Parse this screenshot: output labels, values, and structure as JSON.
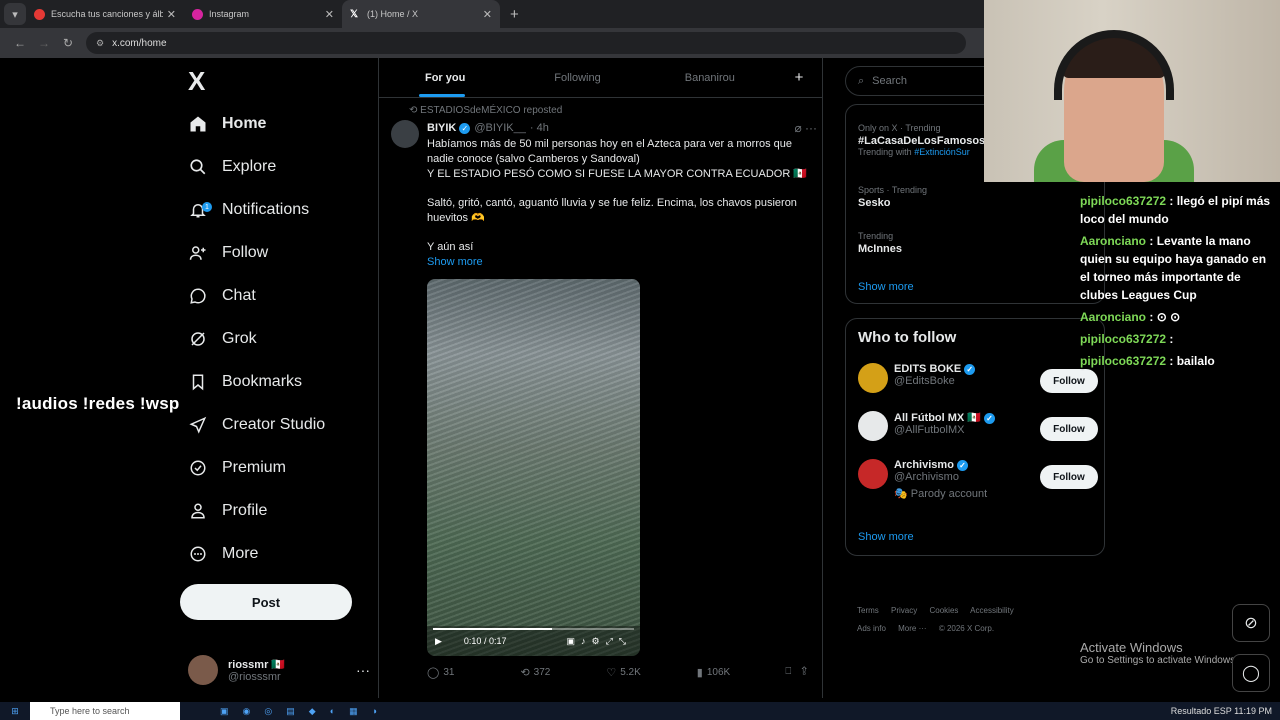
{
  "browser": {
    "tabs": [
      {
        "title": "Escucha tus canciones y álbum",
        "color": "#e53935",
        "active": false
      },
      {
        "title": "Instagram",
        "color": "#d6249f",
        "active": false
      },
      {
        "title": "(1) Home / X",
        "color": "#ffffff",
        "active": true
      }
    ],
    "url": "x.com/home",
    "new_tab": "+"
  },
  "left_nav": {
    "logo": "X",
    "items": [
      {
        "label": "Home",
        "icon": "home-icon"
      },
      {
        "label": "Explore",
        "icon": "search-icon"
      },
      {
        "label": "Notifications",
        "icon": "bell-icon",
        "badge": "1"
      },
      {
        "label": "Follow",
        "icon": "person-plus-icon"
      },
      {
        "label": "Chat",
        "icon": "chat-bubble-icon"
      },
      {
        "label": "Grok",
        "icon": "grok-icon"
      },
      {
        "label": "Bookmarks",
        "icon": "bookmark-icon"
      },
      {
        "label": "Creator Studio",
        "icon": "rocket-icon"
      },
      {
        "label": "Premium",
        "icon": "premium-icon"
      },
      {
        "label": "Profile",
        "icon": "profile-icon"
      },
      {
        "label": "More",
        "icon": "more-circle-icon"
      }
    ],
    "post_label": "Post",
    "account": {
      "name": "riossmr 🇲🇽",
      "handle": "@riosssmr",
      "more": "···"
    }
  },
  "overlay_text": "!audios !redes !wsp",
  "timeline": {
    "tabs": [
      "For you",
      "Following",
      "Bananirou"
    ],
    "add_tab": "+",
    "tweet": {
      "repost_by": "ESTADIOSdeMÉXICO reposted",
      "name": "BIYIK",
      "handle": "@BIYIK__",
      "time": "· 4h",
      "text1": "Habíamos más de 50 mil personas hoy en el Azteca para ver a morros que nadie conoce (salvo Camberos y Sandoval)",
      "text2": "Y EL ESTADIO PESÓ COMO SI FUESE LA MAYOR CONTRA ECUADOR 🇲🇽",
      "text3": "Saltó, gritó, cantó, aguantó lluvia y se fue feliz. Encima, los chavos pusieron huevitos 🫶",
      "text4": "Y aún así",
      "show_more": "Show more",
      "video_time": "0:10 / 0:17",
      "video_progress": 0.59,
      "replies": "31",
      "reposts": "372",
      "likes": "5.2K",
      "views": "106K"
    }
  },
  "sidebar": {
    "search_placeholder": "Search",
    "trends": [
      {
        "context": "Only on X · Trending",
        "name": "#LaCasaDeLosFamosos",
        "with_prefix": "Trending with",
        "with_tag": "#ExtinciónSur"
      },
      {
        "context": "Sports · Trending",
        "name": "Sesko"
      },
      {
        "context": "Trending",
        "name": "McInnes"
      }
    ],
    "trends_show_more": "Show more",
    "who_to_follow_title": "Who to follow",
    "who_to_follow": [
      {
        "name": "EDITS BOKE",
        "handle": "@EditsBoke",
        "color": "#d4a017",
        "follow": "Follow"
      },
      {
        "name": "All Fútbol MX 🇲🇽",
        "handle": "@AllFutbolMX",
        "color": "#e7e9ea",
        "follow": "Follow"
      },
      {
        "name": "Archivismo",
        "handle": "@Archivismo",
        "color": "#c62828",
        "follow": "Follow",
        "note": "🎭 Parody account"
      }
    ],
    "wtf_show_more": "Show more",
    "footer": [
      "Terms",
      "Privacy",
      "Cookies",
      "Accessibility",
      "Ads info",
      "More ···",
      "© 2026 X Corp."
    ]
  },
  "stream_chat": [
    {
      "user": "pipiloco637272",
      "text": ": llegó el pipí más loco del mundo"
    },
    {
      "user": "Aaronciano",
      "text": ": Levante la mano quien su equipo haya ganado en el torneo más importante de clubes Leagues Cup"
    },
    {
      "user": "Aaronciano",
      "text": ": ⊙ ⊙"
    },
    {
      "user": "pipiloco637272",
      "text": ":"
    },
    {
      "user": "pipiloco637272",
      "text": ": bailalo"
    }
  ],
  "windows": {
    "activate_title": "Activate Windows",
    "activate_sub": "Go to Settings to activate Windows.",
    "taskbar_search": "Type here to search",
    "tray_weather": "Resultado",
    "tray_lang": "ESP",
    "tray_time": "11:19 PM"
  }
}
